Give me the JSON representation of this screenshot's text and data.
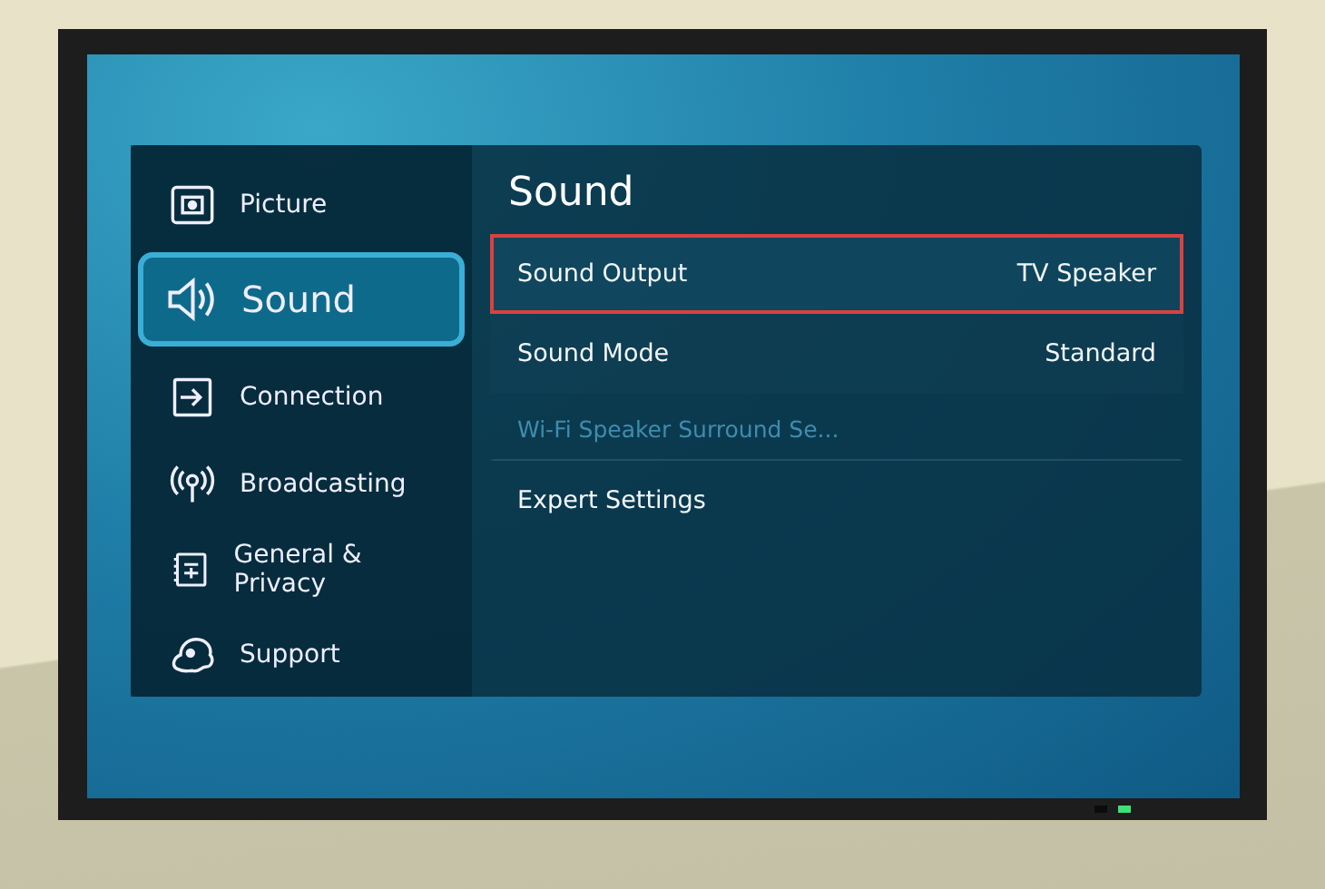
{
  "sidebar": {
    "items": [
      {
        "label": "Picture",
        "kind": "picture",
        "selected": false
      },
      {
        "label": "Sound",
        "kind": "sound",
        "selected": true
      },
      {
        "label": "Connection",
        "kind": "connection",
        "selected": false
      },
      {
        "label": "Broadcasting",
        "kind": "broadcasting",
        "selected": false
      },
      {
        "label": "General & Privacy",
        "kind": "general",
        "selected": false
      },
      {
        "label": "Support",
        "kind": "support",
        "selected": false
      }
    ]
  },
  "panel": {
    "title": "Sound",
    "items": [
      {
        "label": "Sound Output",
        "value": "TV Speaker",
        "selected": true,
        "disabled": false
      },
      {
        "label": "Sound Mode",
        "value": "Standard",
        "selected": false,
        "disabled": false
      },
      {
        "label": "Wi-Fi Speaker Surround Se...",
        "selected": false,
        "disabled": true
      },
      {
        "label": "Expert Settings",
        "selected": false,
        "disabled": false
      }
    ]
  }
}
